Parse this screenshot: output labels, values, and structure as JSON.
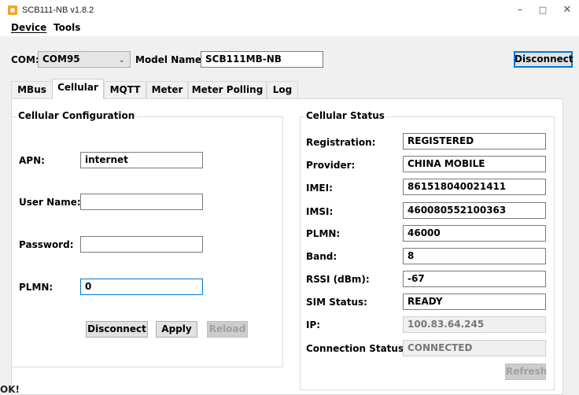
{
  "window": {
    "title": "SCB111-NB v1.8.2",
    "controls": {
      "minimize": "–",
      "maximize": "□",
      "close": "✕"
    }
  },
  "menu": {
    "device": "Device",
    "tools": "Tools"
  },
  "toolbar": {
    "com_label": "COM:",
    "com_value": "COM95",
    "model_label": "Model Name:",
    "model_value": "SCB111MB-NB",
    "disconnect_label": "Disconnect"
  },
  "tabs": [
    {
      "label": "MBus"
    },
    {
      "label": "Cellular"
    },
    {
      "label": "MQTT"
    },
    {
      "label": "Meter"
    },
    {
      "label": "Meter Polling"
    },
    {
      "label": "Log"
    }
  ],
  "config": {
    "title": "Cellular Configuration",
    "apn_label": "APN:",
    "apn_value": "internet",
    "user_label": "User Name:",
    "user_value": "",
    "password_label": "Password:",
    "password_value": "",
    "plmn_label": "PLMN:",
    "plmn_value": "0",
    "disconnect_label": "Disconnect",
    "apply_label": "Apply",
    "reload_label": "Reload"
  },
  "status": {
    "title": "Cellular Status",
    "registration_label": "Registration:",
    "registration_value": "REGISTERED",
    "provider_label": "Provider:",
    "provider_value": "CHINA MOBILE",
    "imei_label": "IMEI:",
    "imei_value": "861518040021411",
    "imsi_label": "IMSI:",
    "imsi_value": "460080552100363",
    "plmn_label": "PLMN:",
    "plmn_value": "46000",
    "band_label": "Band:",
    "band_value": "8",
    "rssi_label": "RSSI (dBm):",
    "rssi_value": "-67",
    "sim_label": "SIM Status:",
    "sim_value": "READY",
    "ip_label": "IP:",
    "ip_value": "100.83.64.245",
    "conn_label": "Connection Status:",
    "conn_value": "CONNECTED",
    "refresh_label": "Refresh"
  },
  "statusbar": {
    "message": "OK!"
  },
  "colors": {
    "accent": "#0078d7",
    "app_icon": "#f5a21b"
  }
}
